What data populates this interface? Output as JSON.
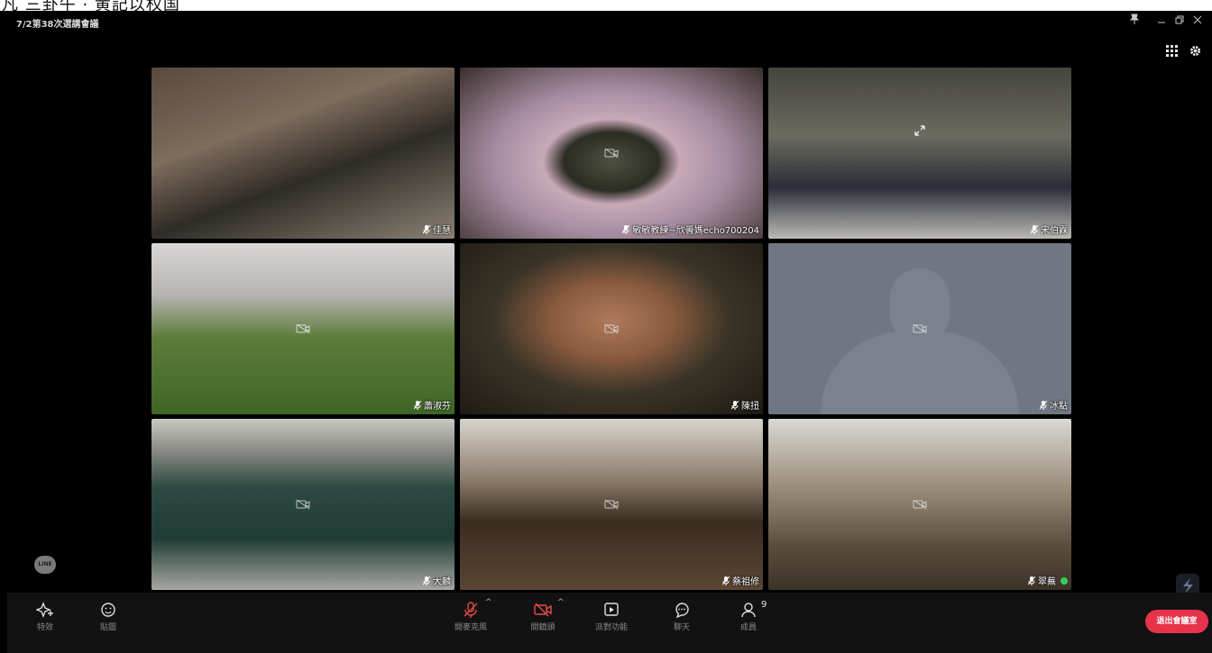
{
  "page_header_fragment": "凡 三卦午 · 黄記以权国",
  "window": {
    "title": "7/2第38次選講會議",
    "controls": [
      "pin-icon",
      "minimize-icon",
      "restore-icon",
      "close-icon"
    ]
  },
  "top_right": {
    "layout_icon": "grid-icon",
    "settings_icon": "gear-icon"
  },
  "participants": [
    {
      "name": "佳慧",
      "mic": "mic-muted"
    },
    {
      "name": "敏敏教練~欣曇媽echo700204",
      "mic": "mic-muted"
    },
    {
      "name": "宋伯霖",
      "mic": "mic-muted"
    },
    {
      "name": "蕭淑芬",
      "mic": "mic-muted"
    },
    {
      "name": "陳扭",
      "mic": "mic-muted"
    },
    {
      "name": "冰點",
      "mic": "mic-muted",
      "video": "off-avatar"
    },
    {
      "name": "大麟",
      "mic": "mic-muted"
    },
    {
      "name": "蔡祖修",
      "mic": "mic-muted"
    },
    {
      "name": "翠蕪",
      "mic": "mic-muted",
      "speaking": true
    }
  ],
  "toolbar": {
    "effects": "特效",
    "stickers": "貼圖",
    "mic": "開麥克風",
    "camera": "開鏡頭",
    "share": "派對功能",
    "chat": "聊天",
    "members": "成員",
    "member_count": "9",
    "leave": "退出會議室"
  },
  "branding": {
    "line_logo": "LINE"
  },
  "colors": {
    "background": "#000000",
    "toolbar": "#121212",
    "leave_button": "#e8324b",
    "speaking_indicator": "#2fd15a"
  }
}
